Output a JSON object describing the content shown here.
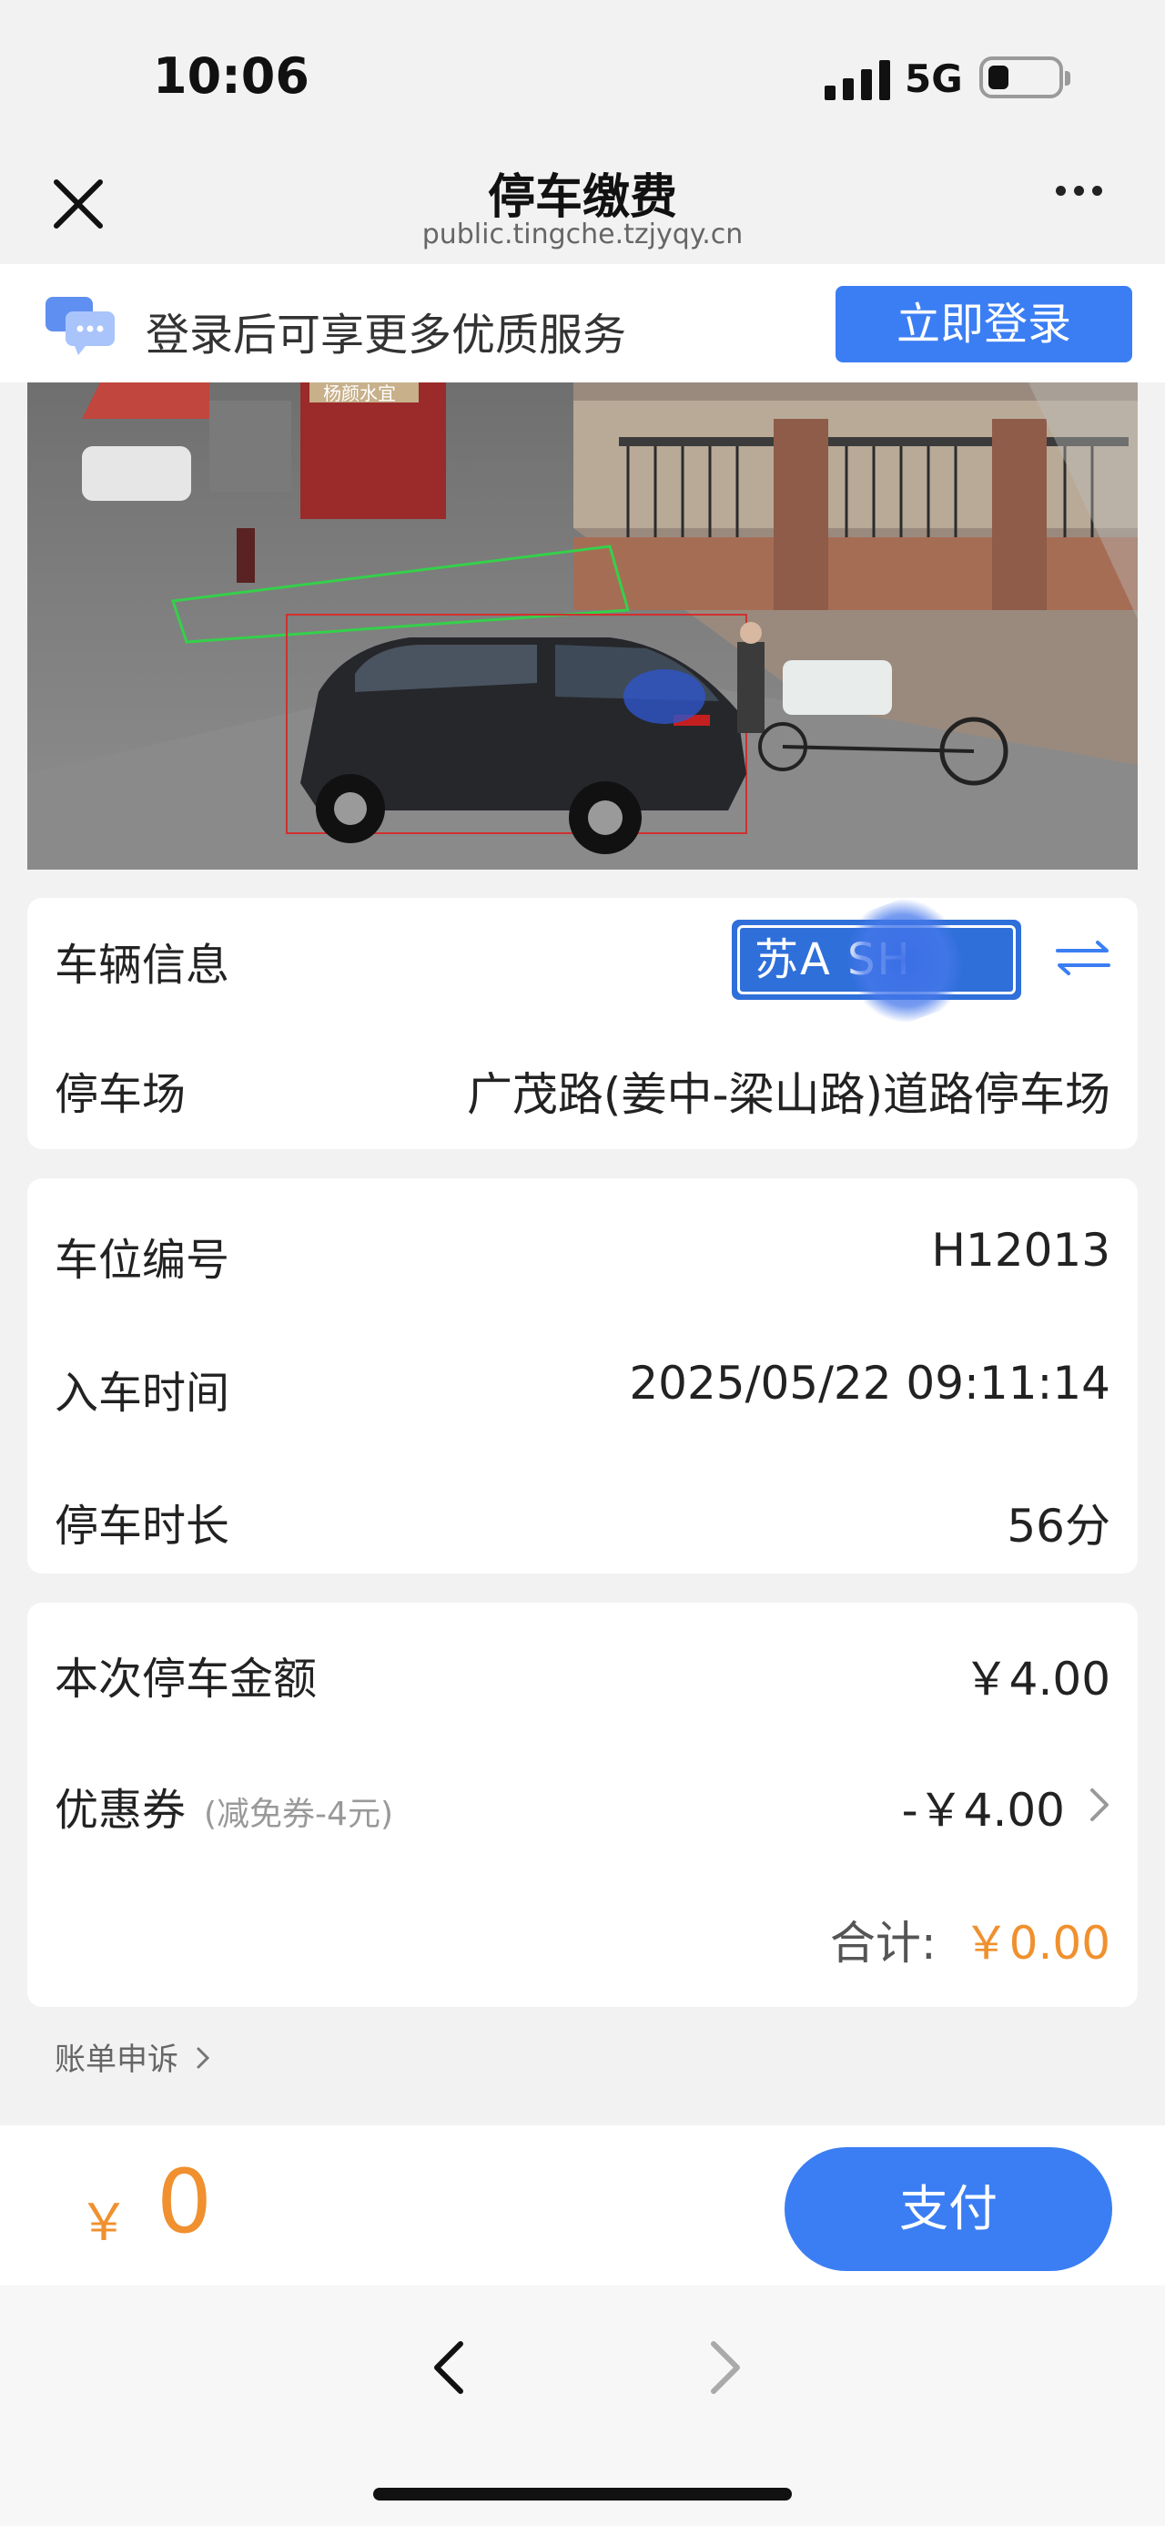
{
  "status": {
    "time": "10:06",
    "network": "5G"
  },
  "nav": {
    "title": "停车缴费",
    "url": "public.tingche.tzjyqy.cn"
  },
  "login": {
    "text": "登录后可享更多优质服务",
    "button": "立即登录"
  },
  "photo": {
    "shop_sign": "杨颜水宜"
  },
  "vehicle": {
    "label": "车辆信息",
    "plate": "苏A SH",
    "lot_label": "停车场",
    "lot": "广茂路(姜中-梁山路)道路停车场"
  },
  "parking": {
    "space_label": "车位编号",
    "space": "H12013",
    "entry_label": "入车时间",
    "entry": "2025/05/22 09:11:14",
    "duration_label": "停车时长",
    "duration": "56分"
  },
  "fee": {
    "amount_label": "本次停车金额",
    "amount": "￥4.00",
    "coupon_label": "优惠券",
    "coupon_note": "(减免券-4元)",
    "coupon_value": "-￥4.00",
    "total_label": "合计:",
    "total": "￥0.00"
  },
  "appeal": "账单申诉",
  "paybar": {
    "currency": "￥",
    "amount": "0",
    "button": "支付"
  },
  "colors": {
    "primary": "#3b7ef3",
    "accent": "#f0902e"
  }
}
